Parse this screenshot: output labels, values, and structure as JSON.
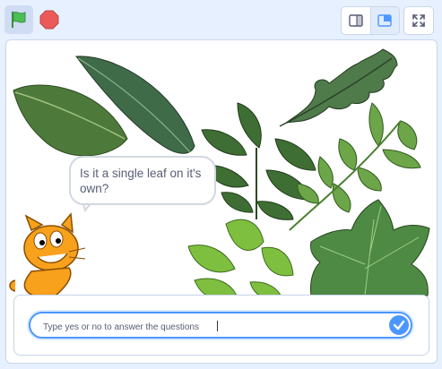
{
  "toolbar": {
    "green_flag_icon": "green-flag-icon",
    "stop_icon": "stop-sign-icon",
    "small_stage_icon": "small-stage-icon",
    "normal_stage_icon": "normal-stage-icon",
    "fullscreen_icon": "fullscreen-icon",
    "active_mode": "normal"
  },
  "stage": {
    "speech_text": "Is it a single leaf on it's own?"
  },
  "ask": {
    "placeholder": "Type yes or no to answer the questions",
    "value": ""
  },
  "colors": {
    "accent": "#4c97ff",
    "background": "#e6f0ff",
    "flag_green": "#4cbf56",
    "stop_red": "#ec5959"
  }
}
